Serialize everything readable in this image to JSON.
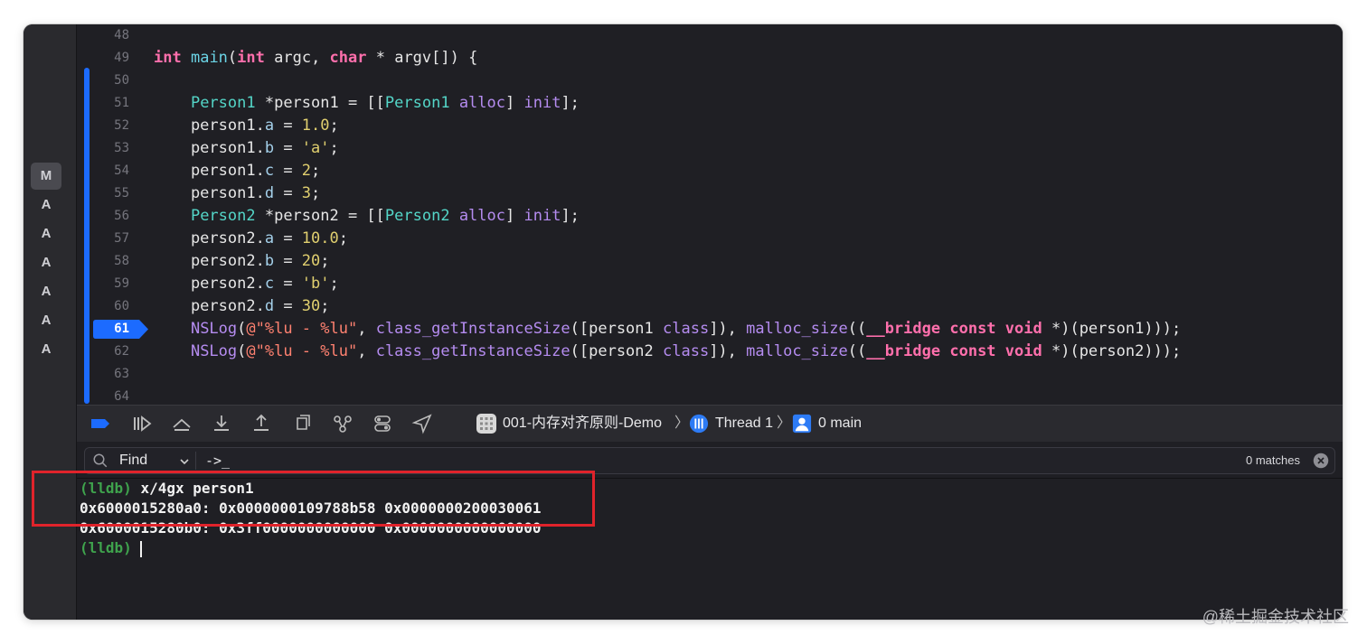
{
  "scm_status": [
    "M",
    "A",
    "A",
    "A",
    "A",
    "A",
    "A"
  ],
  "code_lines": [
    {
      "num": "48",
      "tokens": []
    },
    {
      "num": "49",
      "tokens": [
        [
          "kw",
          "int"
        ],
        [
          "t",
          " "
        ],
        [
          "fn",
          "main"
        ],
        [
          "t",
          "("
        ],
        [
          "kw",
          "int"
        ],
        [
          "t",
          " argc, "
        ],
        [
          "kw",
          "char"
        ],
        [
          "t",
          " * argv[]) {"
        ]
      ]
    },
    {
      "num": "50",
      "tokens": []
    },
    {
      "num": "51",
      "tokens": [
        [
          "t",
          "    "
        ],
        [
          "typ",
          "Person1"
        ],
        [
          "t",
          " *person1 = [["
        ],
        [
          "typ",
          "Person1"
        ],
        [
          "t",
          " "
        ],
        [
          "meth",
          "alloc"
        ],
        [
          "t",
          "] "
        ],
        [
          "meth",
          "init"
        ],
        [
          "t",
          "];"
        ]
      ]
    },
    {
      "num": "52",
      "tokens": [
        [
          "t",
          "    person1."
        ],
        [
          "prop",
          "a"
        ],
        [
          "t",
          " = "
        ],
        [
          "num",
          "1.0"
        ],
        [
          "t",
          ";"
        ]
      ]
    },
    {
      "num": "53",
      "tokens": [
        [
          "t",
          "    person1."
        ],
        [
          "prop",
          "b"
        ],
        [
          "t",
          " = "
        ],
        [
          "num",
          "'a'"
        ],
        [
          "t",
          ";"
        ]
      ]
    },
    {
      "num": "54",
      "tokens": [
        [
          "t",
          "    person1."
        ],
        [
          "prop",
          "c"
        ],
        [
          "t",
          " = "
        ],
        [
          "num",
          "2"
        ],
        [
          "t",
          ";"
        ]
      ]
    },
    {
      "num": "55",
      "tokens": [
        [
          "t",
          "    person1."
        ],
        [
          "prop",
          "d"
        ],
        [
          "t",
          " = "
        ],
        [
          "num",
          "3"
        ],
        [
          "t",
          ";"
        ]
      ]
    },
    {
      "num": "56",
      "tokens": [
        [
          "t",
          "    "
        ],
        [
          "typ",
          "Person2"
        ],
        [
          "t",
          " *person2 = [["
        ],
        [
          "typ",
          "Person2"
        ],
        [
          "t",
          " "
        ],
        [
          "meth",
          "alloc"
        ],
        [
          "t",
          "] "
        ],
        [
          "meth",
          "init"
        ],
        [
          "t",
          "];"
        ]
      ]
    },
    {
      "num": "57",
      "tokens": [
        [
          "t",
          "    person2."
        ],
        [
          "prop",
          "a"
        ],
        [
          "t",
          " = "
        ],
        [
          "num",
          "10.0"
        ],
        [
          "t",
          ";"
        ]
      ]
    },
    {
      "num": "58",
      "tokens": [
        [
          "t",
          "    person2."
        ],
        [
          "prop",
          "b"
        ],
        [
          "t",
          " = "
        ],
        [
          "num",
          "20"
        ],
        [
          "t",
          ";"
        ]
      ]
    },
    {
      "num": "59",
      "tokens": [
        [
          "t",
          "    person2."
        ],
        [
          "prop",
          "c"
        ],
        [
          "t",
          " = "
        ],
        [
          "num",
          "'b'"
        ],
        [
          "t",
          ";"
        ]
      ]
    },
    {
      "num": "60",
      "tokens": [
        [
          "t",
          "    person2."
        ],
        [
          "prop",
          "d"
        ],
        [
          "t",
          " = "
        ],
        [
          "num",
          "30"
        ],
        [
          "t",
          ";"
        ]
      ]
    },
    {
      "num": "61",
      "tokens": [
        [
          "t",
          "    "
        ],
        [
          "meth",
          "NSLog"
        ],
        [
          "t",
          "("
        ],
        [
          "str",
          "@\"%lu - %lu\""
        ],
        [
          "t",
          ", "
        ],
        [
          "meth",
          "class_getInstanceSize"
        ],
        [
          "t",
          "([person1 "
        ],
        [
          "meth",
          "class"
        ],
        [
          "t",
          "]), "
        ],
        [
          "meth",
          "malloc_size"
        ],
        [
          "t",
          "(("
        ],
        [
          "kw",
          "__bridge"
        ],
        [
          "t",
          " "
        ],
        [
          "kw",
          "const"
        ],
        [
          "t",
          " "
        ],
        [
          "kw",
          "void"
        ],
        [
          "t",
          " *)(person1)));"
        ]
      ]
    },
    {
      "num": "62",
      "tokens": [
        [
          "t",
          "    "
        ],
        [
          "meth",
          "NSLog"
        ],
        [
          "t",
          "("
        ],
        [
          "str",
          "@\"%lu - %lu\""
        ],
        [
          "t",
          ", "
        ],
        [
          "meth",
          "class_getInstanceSize"
        ],
        [
          "t",
          "([person2 "
        ],
        [
          "meth",
          "class"
        ],
        [
          "t",
          "]), "
        ],
        [
          "meth",
          "malloc_size"
        ],
        [
          "t",
          "(("
        ],
        [
          "kw",
          "__bridge"
        ],
        [
          "t",
          " "
        ],
        [
          "kw",
          "const"
        ],
        [
          "t",
          " "
        ],
        [
          "kw",
          "void"
        ],
        [
          "t",
          " *)(person2)));"
        ]
      ]
    },
    {
      "num": "63",
      "tokens": []
    },
    {
      "num": "64",
      "tokens": []
    }
  ],
  "breakpoint_line": "61",
  "breadcrumb": {
    "target": "001-内存对齐原则-Demo",
    "thread": "Thread 1",
    "frame": "0 main"
  },
  "find": {
    "mode": "Find",
    "query": "->_",
    "matches": "0 matches"
  },
  "console": {
    "command_prompt": "(lldb)",
    "command": "x/4gx person1",
    "output": [
      "0x6000015280a0: 0x0000000109788b58 0x0000000200030061",
      "0x6000015280b0: 0x3ff0000000000000 0x0000000000000000"
    ],
    "final_prompt": "(lldb)"
  },
  "watermark": "@稀土掘金技术社区",
  "colors": {
    "accent_blue": "#1c6bff",
    "highlight_red": "#e0232b",
    "prompt_green": "#3fa34d"
  }
}
